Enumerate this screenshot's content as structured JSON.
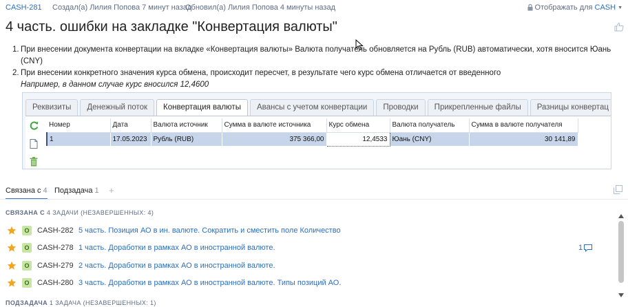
{
  "header": {
    "task_key": "CASH-281",
    "created": "Создал(а) Лилия Попова 7 минут назад",
    "updated": "Обновил(а) Лилия Попова 4 минуты назад",
    "visibility_label": "Отображать для",
    "visibility_project": "CASH"
  },
  "title": "4 часть. ошибки на закладке \"Конвертация валюты\"",
  "description": {
    "items": [
      {
        "num": "1.",
        "text": "При внесении документа конвертации на вкладке «Конвертация валюты» Валюта получатель обновляется на Рубль (RUB) автоматически, хотя вносится Юань (CNY)"
      },
      {
        "num": "2.",
        "text": "При внесении конкретного значения курса обмена, происходит пересчет, в результате чего курс обмена отличается от введенного",
        "example": "Например, в данном случае курс вносился 12,4600"
      }
    ]
  },
  "screenshot": {
    "tabs": [
      "Реквизиты",
      "Денежный поток",
      "Конвертация валюты",
      "Авансы с учетом конвертации",
      "Проводки",
      "Прикрепленные файлы",
      "Разницы конвертац"
    ],
    "active_tab": "Конвертация валюты",
    "columns": [
      "Номер",
      "Дата",
      "Валюта источник",
      "Сумма в валюте источника",
      "Курс обмена",
      "Валюта получатель",
      "Сумма в валюте получателя"
    ],
    "row": [
      "1",
      "17.05.2023",
      "Рубль (RUB)",
      "375 366,00",
      "12,4533",
      "Юань (CNY)",
      "30 141,89"
    ]
  },
  "links": {
    "tab_related": "Связана с",
    "tab_related_count": "4",
    "tab_subtask": "Подзадача",
    "tab_subtask_count": "1",
    "add": "+",
    "related_heading": "СВЯЗАНА С",
    "related_heading_rest": "4 ЗАДАЧИ (НЕЗАВЕРШЕННЫХ: 4)",
    "subtask_heading": "ПОДЗАДАЧА",
    "subtask_heading_rest": "1 ЗАДАЧА (НЕЗАВЕРШЕННЫХ: 1)",
    "items": [
      {
        "status": "О",
        "key": "CASH-282",
        "title": "5 часть. Позиция АО в ин. валюте. Сократить и сместить поле Количество",
        "comments": ""
      },
      {
        "status": "О",
        "key": "CASH-278",
        "title": "1 часть. Доработки в рамках АО в иностранной валюте.",
        "comments": "1"
      },
      {
        "status": "О",
        "key": "CASH-279",
        "title": "2 часть. Доработки в рамках АО в иностранной валюте.",
        "comments": ""
      },
      {
        "status": "О",
        "key": "CASH-280",
        "title": "3 часть. Доработки в рамках АО в иностранной валюте. Типы позиций АО.",
        "comments": ""
      }
    ]
  },
  "colors": {
    "link": "#2a6ebb",
    "star": "#f2a61f",
    "status_bg": "#c7e6a5",
    "selected_row": "#c6d5ea"
  },
  "icons": {
    "refresh": "refresh-icon",
    "new_doc": "new-document-icon",
    "delete": "trash-icon",
    "like": "like-icon",
    "lock": "lock-icon",
    "star": "star-icon",
    "comment": "comment-icon",
    "copy": "copy-icon"
  }
}
